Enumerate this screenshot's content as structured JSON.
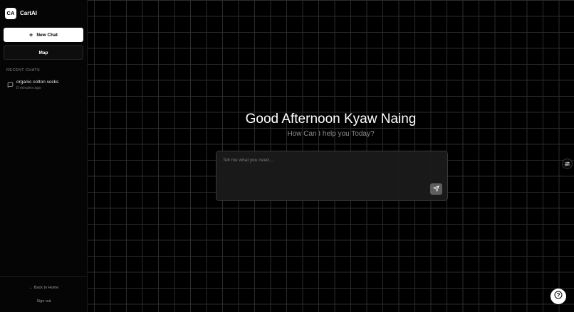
{
  "brand": {
    "logo_text": "CA",
    "name": "CartAI"
  },
  "sidebar": {
    "new_chat_label": "New Chat",
    "map_label": "Map",
    "recent_title": "RECENT CHATS",
    "recent_chats": [
      {
        "title": "organic cotton socks",
        "time": "8 minutes ago"
      }
    ],
    "back_home_label": "← Back to Home",
    "sign_out_label": "Sign out"
  },
  "main": {
    "greeting": "Good Afternoon Kyaw Naing",
    "subgreeting": "How Can I help you Today?",
    "input_placeholder": "Tell me what you need...",
    "input_value": ""
  },
  "icons": {
    "plus": "plus-icon",
    "chat": "message-square-icon",
    "send": "send-icon",
    "settings": "sliders-icon",
    "help": "help-circle-icon"
  },
  "colors": {
    "background": "#000000",
    "grid_line": "#2c2c2c",
    "primary_button": "#ffffff",
    "send_button": "#5e5e5e"
  }
}
